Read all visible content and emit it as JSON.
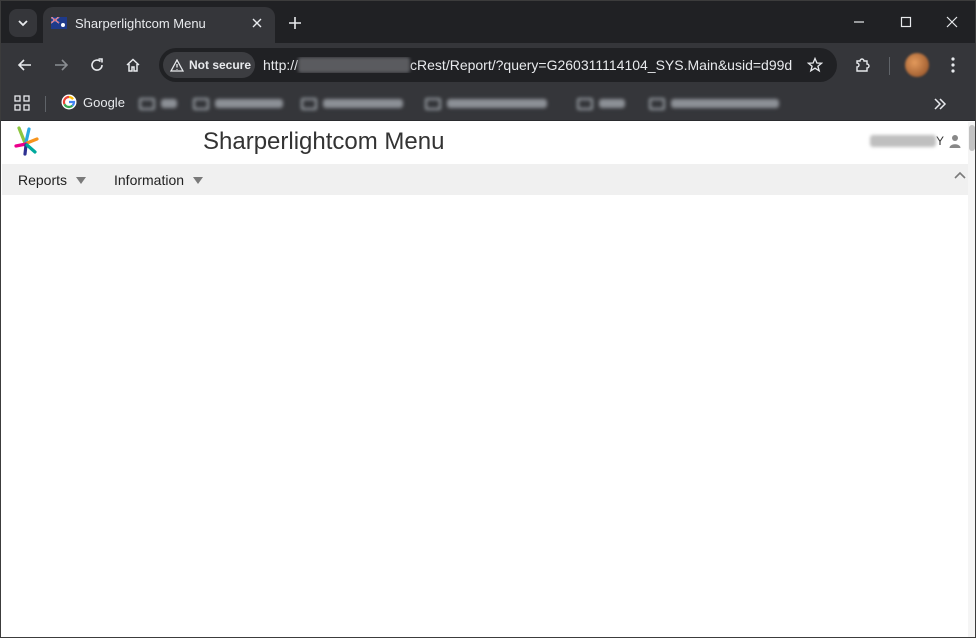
{
  "browser": {
    "tab": {
      "title": "Sharperlightcom Menu",
      "favicon": "flag-icon"
    },
    "address_bar": {
      "security_label": "Not secure",
      "url_prefix": "http://",
      "url_redacted_part": "xxxxxxxxxxxxxxxx",
      "url_suffix": "cRest/Report/?query=G260311114104_SYS.Main&usid=d99d..."
    },
    "bookmarks": {
      "google_label": "Google"
    },
    "colors": {
      "chrome_dark": "#202124",
      "chrome_toolbar": "#35363a",
      "text_light": "#e8eaed"
    }
  },
  "page": {
    "title": "Sharperlightcom Menu",
    "user_suffix": "Y",
    "menu": {
      "items": [
        {
          "label": "Reports"
        },
        {
          "label": "Information"
        }
      ]
    },
    "colors": {
      "menubar_bg": "#f0f0f0",
      "title_text": "#333333"
    }
  }
}
